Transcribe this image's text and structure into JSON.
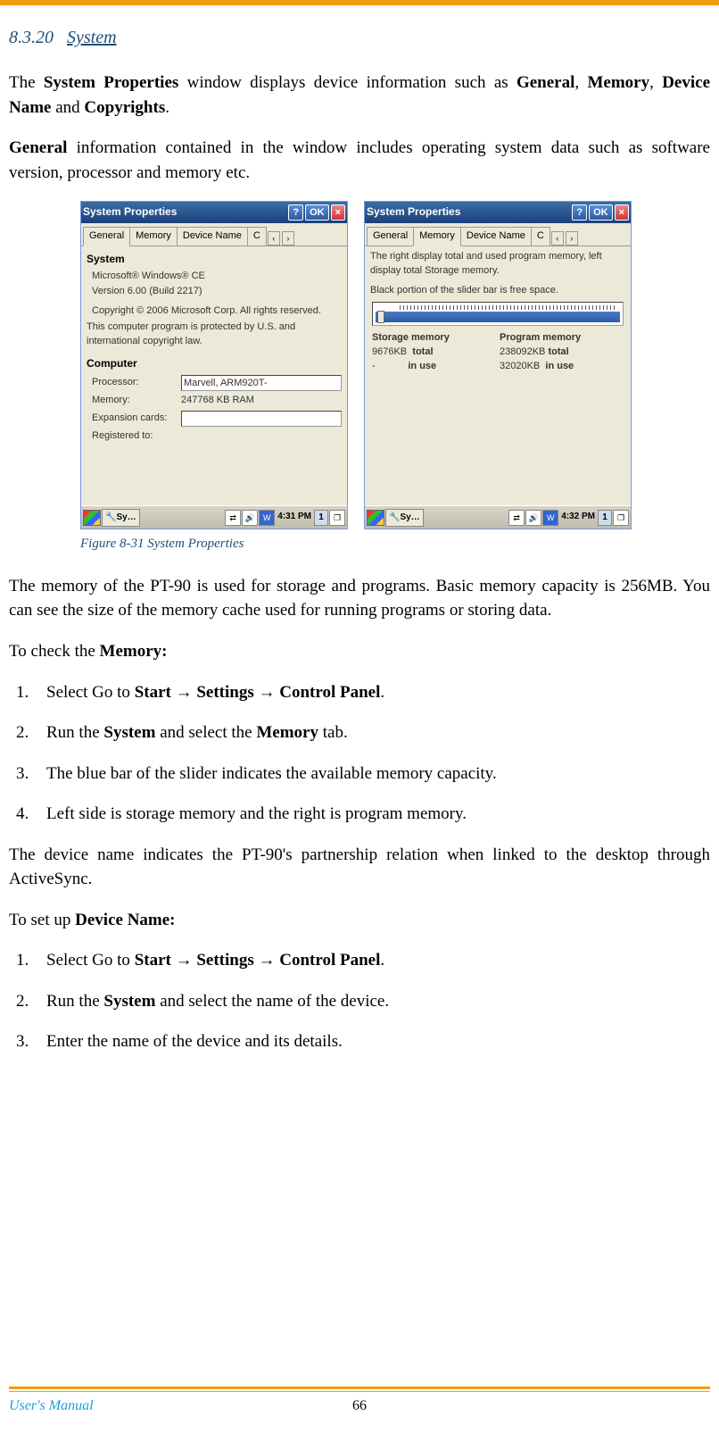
{
  "section": {
    "number": "8.3.20",
    "title": "System"
  },
  "para1": {
    "pre": "The ",
    "b1": "System Properties",
    "mid1": " window displays device information such as ",
    "b2": "General",
    "sep1": ", ",
    "b3": "Memory",
    "sep2": ", ",
    "b4": "Device Name",
    "sep3": " and ",
    "b5": "Copyrights",
    "end": "."
  },
  "para2": {
    "b1": "General",
    "rest": " information contained in the window includes operating system data such as software version, processor and memory etc."
  },
  "win_title": "System Properties",
  "titlebar_buttons": {
    "help": "?",
    "ok": "OK",
    "close": "×"
  },
  "tabs": {
    "general": "General",
    "memory": "Memory",
    "device_name": "Device Name",
    "copy": "C"
  },
  "left_win": {
    "system_label": "System",
    "os": "Microsoft® Windows® CE",
    "version": "Version 6.00 (Build 2217)",
    "copyright": "Copyright © 2006 Microsoft Corp. All rights reserved.",
    "protected": "This computer program is protected by U.S. and international copyright law.",
    "computer_label": "Computer",
    "processor_label": "Processor:",
    "processor_value": "Marvell, ARM920T-",
    "memory_label": "Memory:",
    "memory_value": "247768 KB  RAM",
    "expansion_label": "Expansion cards:",
    "registered_label": "Registered to:"
  },
  "right_win": {
    "desc1": "The right display total and used program memory, left display total Storage memory.",
    "desc2": "Black portion of the slider bar is free space.",
    "storage_hdr": "Storage memory",
    "program_hdr": "Program memory",
    "storage_total": "9676KB",
    "storage_total_lbl": "total",
    "storage_inuse": "-",
    "storage_inuse_lbl": "in use",
    "program_total": "238092KB",
    "program_total_lbl": "total",
    "program_inuse": "32020KB",
    "program_inuse_lbl": "in use"
  },
  "taskbar": {
    "task": "Sy…",
    "clock_left": "4:31 PM",
    "clock_right": "4:32 PM",
    "num": "1"
  },
  "figure_caption": "Figure 8-31 System Properties",
  "para3": "The memory of the PT-90 is used for storage and programs. Basic memory capacity is 256MB. You can see the size of the memory cache used for running programs or storing data.",
  "check_memory_label_pre": "To check the ",
  "check_memory_label_b": "Memory:",
  "steps_memory": {
    "s1_pre": "Select Go to ",
    "s1_b1": "Start",
    "s1_arr": " → ",
    "s1_b2": "Settings",
    "s1_b3": "Control Panel",
    "s1_end": ".",
    "s2_pre": "Run the ",
    "s2_b1": "System",
    "s2_mid": " and select the ",
    "s2_b2": "Memory",
    "s2_end": " tab.",
    "s3": "The blue bar of the slider indicates the available memory capacity.",
    "s4": "Left side is storage memory and the right is program memory."
  },
  "para4": "The device name indicates the PT-90's partnership relation when linked to the desktop through ActiveSync.",
  "device_name_label_pre": "To set up ",
  "device_name_label_b": "Device Name:",
  "steps_device": {
    "s1_pre": "Select Go to ",
    "s1_b1": "Start",
    "s1_arr": " → ",
    "s1_b2": "Settings",
    "s1_b3": "Control Panel",
    "s1_end": ".",
    "s2_pre": "Run the ",
    "s2_b1": "System",
    "s2_end": " and select the name of the device.",
    "s3": "Enter the name of the device and its details."
  },
  "footer": {
    "left": "User's Manual",
    "page": "66"
  },
  "numbers": {
    "n1": "1.",
    "n2": "2.",
    "n3": "3.",
    "n4": "4."
  }
}
